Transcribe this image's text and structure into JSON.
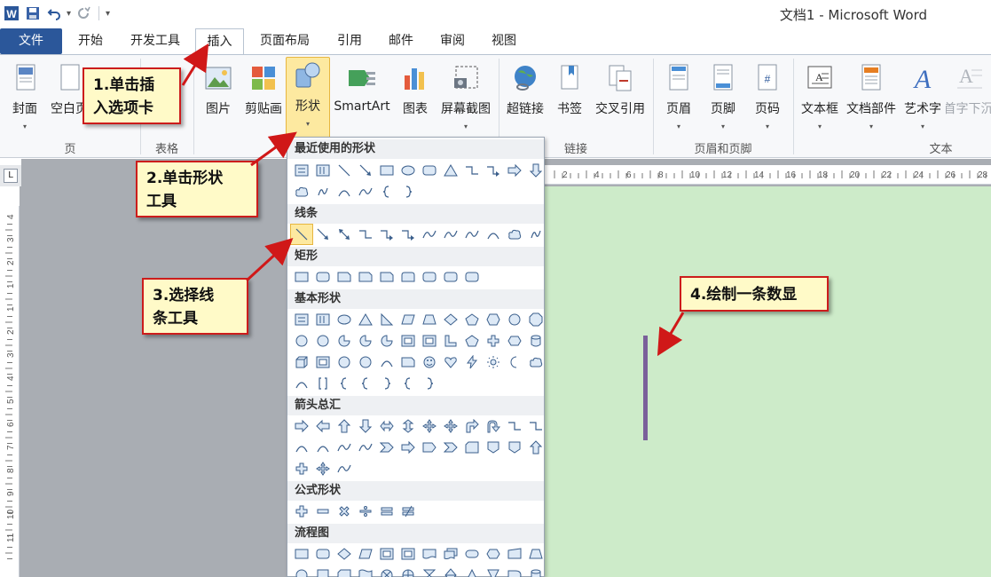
{
  "window": {
    "title": "文档1 - Microsoft Word"
  },
  "quick_access": {
    "undo_dropdown": "▾",
    "customize": "▾"
  },
  "tabs": [
    {
      "label": "文件",
      "name": "tab-file"
    },
    {
      "label": "开始",
      "name": "tab-home"
    },
    {
      "label": "开发工具",
      "name": "tab-developer"
    },
    {
      "label": "插入",
      "name": "tab-insert",
      "active": true
    },
    {
      "label": "页面布局",
      "name": "tab-page-layout"
    },
    {
      "label": "引用",
      "name": "tab-references"
    },
    {
      "label": "邮件",
      "name": "tab-mailings"
    },
    {
      "label": "审阅",
      "name": "tab-review"
    },
    {
      "label": "视图",
      "name": "tab-view"
    }
  ],
  "ribbon": {
    "buttons": {
      "cover": "封面",
      "blank_page": "空白页",
      "picture": "图片",
      "clip_art": "剪贴画",
      "shapes": "形状",
      "smartart": "SmartArt",
      "chart": "图表",
      "screenshot": "屏幕截图",
      "hyperlink": "超链接",
      "bookmark": "书签",
      "cross_ref": "交叉引用",
      "header": "页眉",
      "footer": "页脚",
      "page_number": "页码",
      "textbox": "文本框",
      "quick_parts": "文档部件",
      "wordart": "艺术字",
      "dropcap": "首字下沉"
    },
    "groups": {
      "pages": "页",
      "tables": "表格",
      "links": "链接",
      "header_footer": "页眉和页脚",
      "text": "文本"
    },
    "dropdown": "▾"
  },
  "ruler": {
    "corner": "L",
    "h_ticks": [
      "2",
      "4",
      "6",
      "8",
      "10",
      "12",
      "14",
      "16",
      "18",
      "20",
      "22",
      "24",
      "26",
      "28"
    ],
    "v_ticks": [
      "4",
      "3",
      "2",
      "1",
      "1",
      "2",
      "3",
      "4",
      "5",
      "6",
      "7",
      "8",
      "9",
      "10",
      "11"
    ]
  },
  "gallery": {
    "sections": {
      "recent": "最近使用的形状",
      "lines": "线条",
      "rect": "矩形",
      "basic": "基本形状",
      "arrows": "箭头总汇",
      "equation": "公式形状",
      "flowchart": "流程图"
    }
  },
  "callouts": {
    "step1": "1.单击插\n入选项卡",
    "step2": "2.单击形状\n工具",
    "step3": "3.选择线\n条工具",
    "step4": "4.绘制一条数显"
  },
  "colors": {
    "file_tab": "#2b579a",
    "callout_border": "#cc1c1c",
    "callout_bg": "#fffac8",
    "page_bg": "#cdebc9",
    "drawn_line": "#7a609a",
    "highlight": "#fde9a0"
  }
}
